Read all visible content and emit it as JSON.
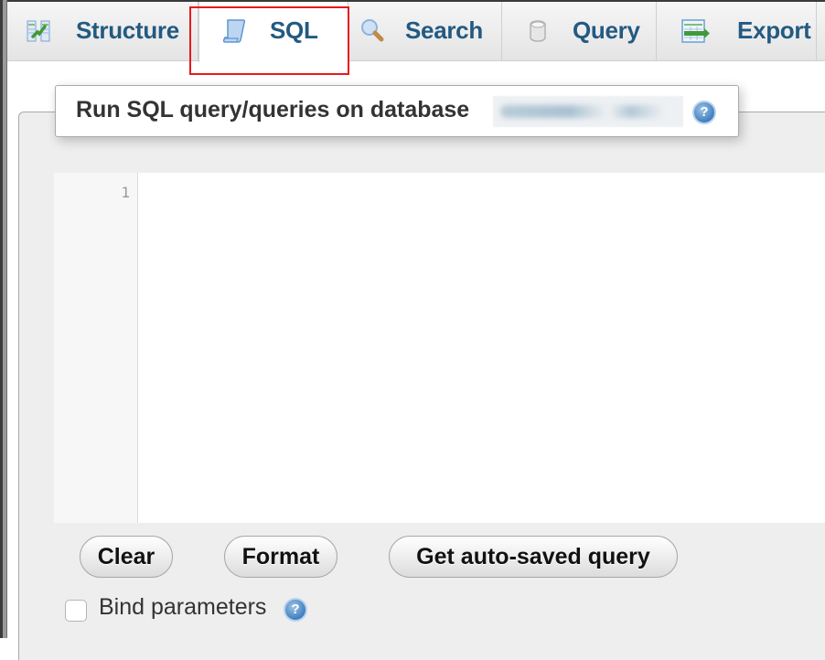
{
  "tabs": [
    {
      "label": "Structure",
      "icon": "structure-icon",
      "active": false
    },
    {
      "label": "SQL",
      "icon": "sql-scroll-icon",
      "active": true
    },
    {
      "label": "Search",
      "icon": "search-magnifier-icon",
      "active": false
    },
    {
      "label": "Query",
      "icon": "query-cylinder-icon",
      "active": false
    },
    {
      "label": "Export",
      "icon": "export-table-icon",
      "active": false
    }
  ],
  "highlight_color": "#e8191c",
  "tab_text_color": "#235a81",
  "sql_panel": {
    "title": "Run SQL query/queries on database",
    "database_name_redacted": "(blurred)",
    "help_glyph": "?"
  },
  "editor": {
    "line_numbers": [
      "1"
    ],
    "content": ""
  },
  "buttons": {
    "clear": "Clear",
    "format": "Format",
    "get_autosaved": "Get auto-saved query"
  },
  "bind_parameters": {
    "label": "Bind parameters",
    "checked": false,
    "help_glyph": "?"
  }
}
